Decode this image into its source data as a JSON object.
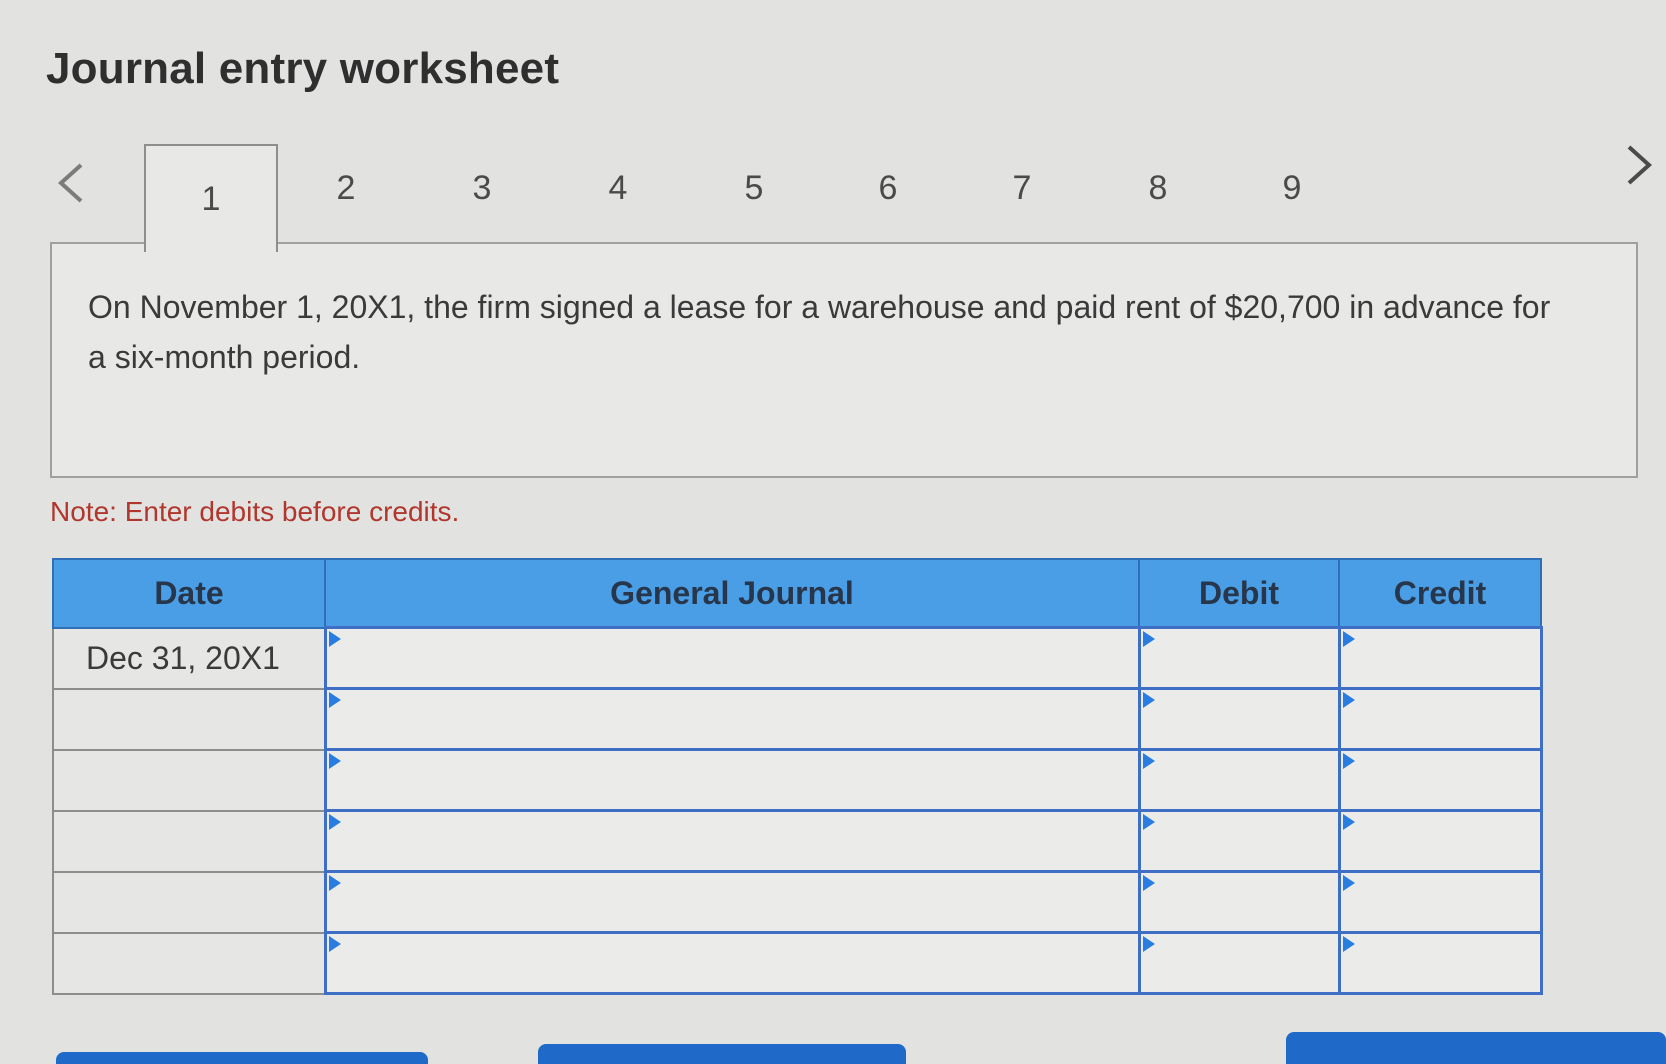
{
  "header": {
    "title": "Journal entry worksheet"
  },
  "tabs": [
    {
      "label": "1",
      "active": true
    },
    {
      "label": "2",
      "active": false
    },
    {
      "label": "3",
      "active": false
    },
    {
      "label": "4",
      "active": false
    },
    {
      "label": "5",
      "active": false
    },
    {
      "label": "6",
      "active": false
    },
    {
      "label": "7",
      "active": false
    },
    {
      "label": "8",
      "active": false
    },
    {
      "label": "9",
      "active": false
    }
  ],
  "prompt": {
    "text": "On November 1, 20X1, the firm signed a lease for a warehouse and paid rent of $20,700 in advance for a six-month period."
  },
  "note": {
    "text": "Note: Enter debits before credits."
  },
  "journal": {
    "headers": {
      "date": "Date",
      "general_journal": "General Journal",
      "debit": "Debit",
      "credit": "Credit"
    },
    "rows": [
      {
        "date": "Dec 31, 20X1",
        "account": "",
        "debit": "",
        "credit": ""
      },
      {
        "date": "",
        "account": "",
        "debit": "",
        "credit": ""
      },
      {
        "date": "",
        "account": "",
        "debit": "",
        "credit": ""
      },
      {
        "date": "",
        "account": "",
        "debit": "",
        "credit": ""
      },
      {
        "date": "",
        "account": "",
        "debit": "",
        "credit": ""
      },
      {
        "date": "",
        "account": "",
        "debit": "",
        "credit": ""
      }
    ]
  },
  "colors": {
    "header_blue": "#4a9ee5",
    "entry_border": "#3e6fc4",
    "note_red": "#b1372e",
    "button_blue": "#1f6ac9"
  }
}
